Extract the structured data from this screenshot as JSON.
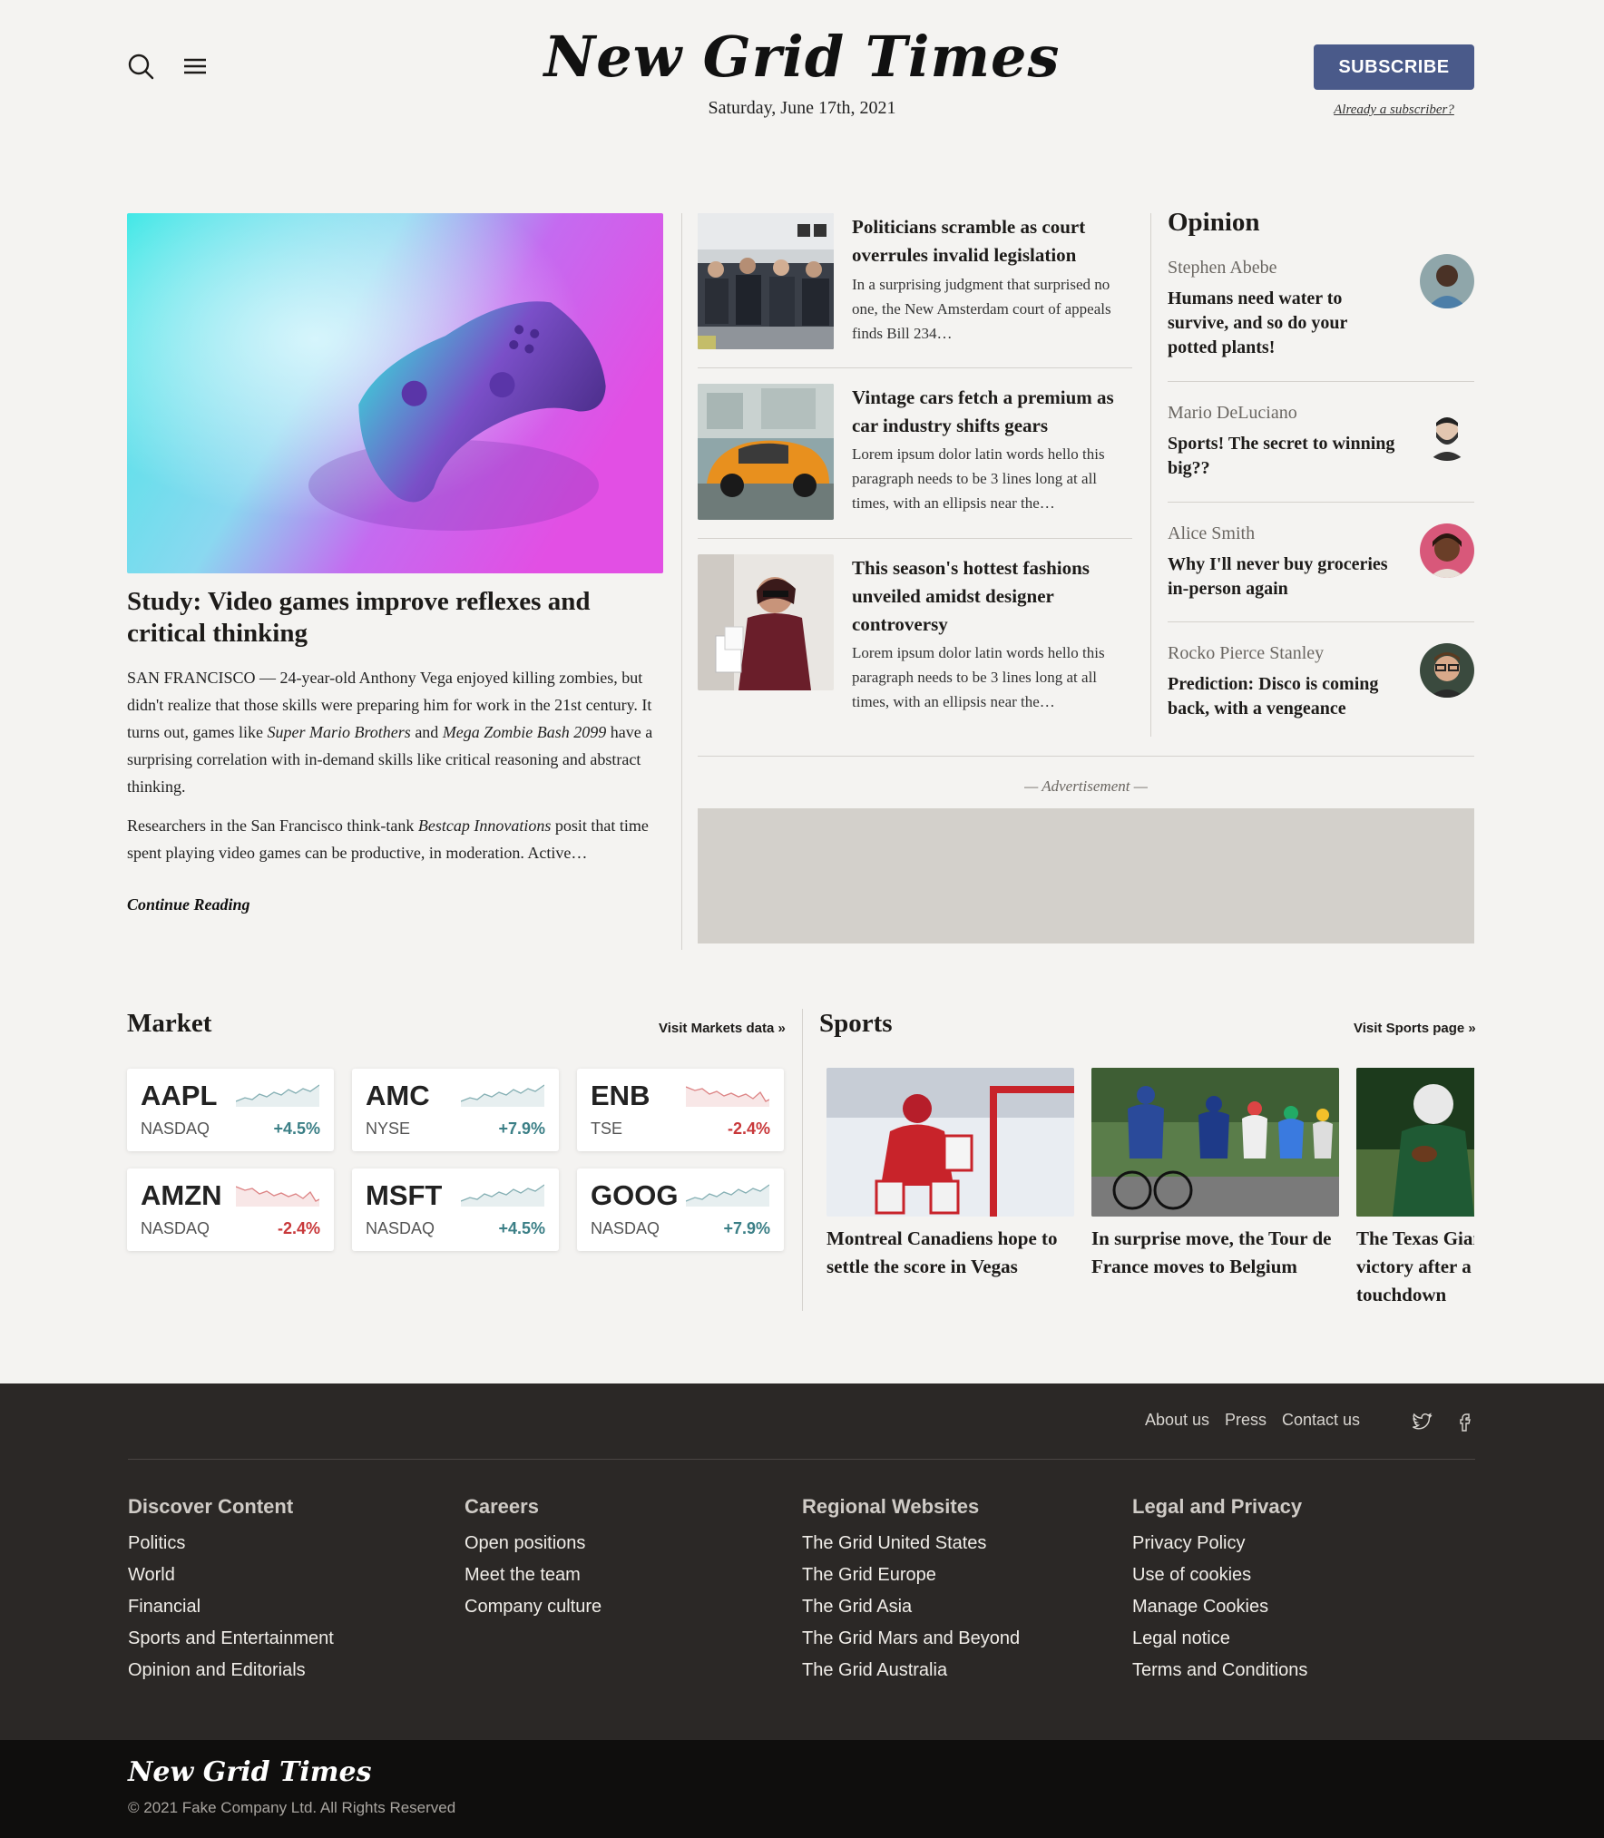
{
  "header": {
    "logo": "New Grid Times",
    "date": "Saturday, June 17th, 2021",
    "subscribe_label": "SUBSCRIBE",
    "already_label": "Already a subscriber?",
    "icons": [
      "search-icon",
      "menu-icon"
    ]
  },
  "lead": {
    "title": "Study: Video games improve reflexes and critical thinking",
    "p1_a": "SAN FRANCISCO — 24-year-old Anthony Vega enjoyed killing zombies, but didn't realize that those skills were preparing him for work in the 21st century. It turns out, games like ",
    "p1_em1": "Super Mario Brothers",
    "p1_b": " and ",
    "p1_em2": "Mega Zombie Bash 2099",
    "p1_c": " have a surprising correlation with in-demand skills like critical reasoning and abstract thinking.",
    "p2_a": "Researchers in the San Francisco think-tank ",
    "p2_em": "Bestcap Innovations",
    "p2_b": " posit that time spent playing video games can be productive, in moderation. Active…",
    "continue_label": "Continue Reading"
  },
  "stories": [
    {
      "title": "Politicians scramble as court overrules invalid legislation",
      "text": "In a surprising judgment that surprised no one, the New Amsterdam court of appeals finds Bill 234…"
    },
    {
      "title": "Vintage cars fetch a premium as car industry shifts gears",
      "text": "Lorem ipsum dolor latin words hello this paragraph needs to be 3 lines long at all times, with an ellipsis near the…"
    },
    {
      "title": "This season's hottest fashions unveiled amidst designer controversy",
      "text": "Lorem ipsum dolor latin words hello this paragraph needs to be 3 lines long at all times, with an ellipsis near the…"
    }
  ],
  "opinion": {
    "heading": "Opinion",
    "items": [
      {
        "author": "Stephen Abebe",
        "title": "Humans need water to survive, and so do your potted plants!"
      },
      {
        "author": "Mario DeLuciano",
        "title": "Sports! The secret to winning big??"
      },
      {
        "author": "Alice Smith",
        "title": "Why I'll never buy groceries in-person again"
      },
      {
        "author": "Rocko Pierce Stanley",
        "title": "Prediction: Disco is coming back, with a vengeance"
      }
    ]
  },
  "ad": {
    "label": "— Advertisement —"
  },
  "market": {
    "heading": "Market",
    "link": "Visit Markets data »",
    "stocks": [
      {
        "ticker": "AAPL",
        "exchange": "NASDAQ",
        "change": "+4.5%",
        "trend": "up"
      },
      {
        "ticker": "AMC",
        "exchange": "NYSE",
        "change": "+7.9%",
        "trend": "up"
      },
      {
        "ticker": "ENB",
        "exchange": "TSE",
        "change": "-2.4%",
        "trend": "down"
      },
      {
        "ticker": "AMZN",
        "exchange": "NASDAQ",
        "change": "-2.4%",
        "trend": "down"
      },
      {
        "ticker": "MSFT",
        "exchange": "NASDAQ",
        "change": "+4.5%",
        "trend": "up"
      },
      {
        "ticker": "GOOG",
        "exchange": "NASDAQ",
        "change": "+7.9%",
        "trend": "up"
      }
    ],
    "colors": {
      "up": "#3b7f86",
      "down": "#c8383a"
    }
  },
  "sports": {
    "heading": "Sports",
    "link": "Visit Sports page »",
    "items": [
      {
        "title": "Montreal Canadiens hope to settle the score in Vegas"
      },
      {
        "title": "In surprise move, the Tour de France moves to Belgium"
      },
      {
        "title": "The Texas Giants celebrate victory after a last-second touchdown"
      }
    ]
  },
  "footer": {
    "top_links": [
      "About us",
      "Press",
      "Contact us"
    ],
    "social_icons": [
      "twitter-icon",
      "facebook-icon"
    ],
    "columns": [
      {
        "title": "Discover Content",
        "links": [
          "Politics",
          "World",
          "Financial",
          "Sports and Entertainment",
          "Opinion and Editorials"
        ]
      },
      {
        "title": "Careers",
        "links": [
          "Open positions",
          "Meet the team",
          "Company culture"
        ]
      },
      {
        "title": "Regional Websites",
        "links": [
          "The Grid United States",
          "The Grid Europe",
          "The Grid Asia",
          "The Grid Mars and Beyond",
          "The Grid Australia"
        ]
      },
      {
        "title": "Legal and Privacy",
        "links": [
          "Privacy Policy",
          "Use of cookies",
          "Manage Cookies",
          "Legal notice",
          "Terms and Conditions"
        ]
      }
    ],
    "bottom_logo": "New Grid Times",
    "copyright": "© 2021 Fake Company Ltd. All Rights Reserved"
  },
  "colors": {
    "background": "#f4f3f1",
    "accent_button": "#4a5a8a",
    "footer": "#2b2826",
    "bottom_bar": "#0f0e0d",
    "ad_box": "#d3d0cb"
  }
}
